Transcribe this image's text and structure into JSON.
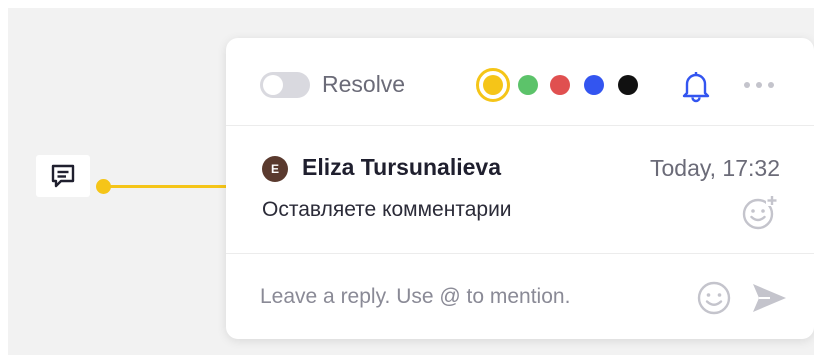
{
  "anchor": {
    "icon": "comment-icon",
    "line_color": "#f5c518"
  },
  "header": {
    "resolve_label": "Resolve",
    "resolved": false,
    "colors": [
      {
        "name": "yellow",
        "hex": "#f5c518",
        "selected": true
      },
      {
        "name": "green",
        "hex": "#5cc36a",
        "selected": false
      },
      {
        "name": "red",
        "hex": "#e05050",
        "selected": false
      },
      {
        "name": "blue",
        "hex": "#3355f0",
        "selected": false
      },
      {
        "name": "black",
        "hex": "#111111",
        "selected": false
      }
    ],
    "notify_icon": "bell-icon",
    "more_icon": "more-icon"
  },
  "comment": {
    "avatar_initial": "E",
    "author": "Eliza Tursunalieva",
    "timestamp": "Today, 17:32",
    "text": "Оставляете комментарии",
    "reaction_icon": "add-reaction-icon"
  },
  "reply": {
    "placeholder": "Leave a reply. Use @ to mention.",
    "value": "",
    "emoji_icon": "emoji-icon",
    "send_icon": "send-icon"
  }
}
